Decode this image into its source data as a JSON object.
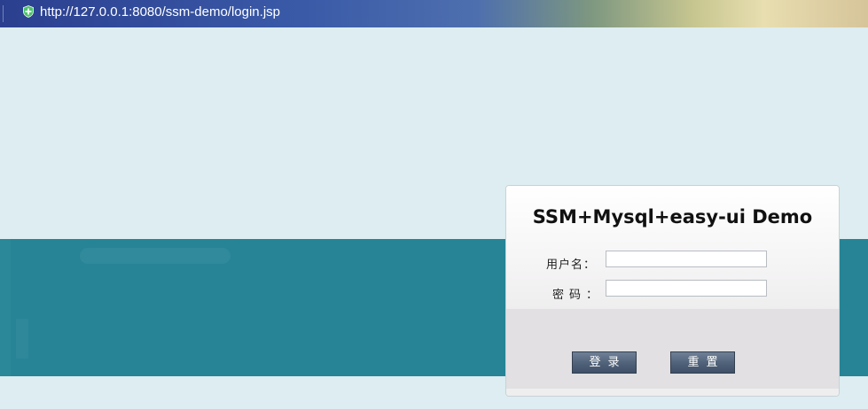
{
  "browser": {
    "url": "http://127.0.0.1:8080/ssm-demo/login.jsp",
    "secure_icon": "shield-plus-icon"
  },
  "login": {
    "title": "SSM+Mysql+easy-ui Demo",
    "username_label": "用户名：",
    "password_label": "密码：",
    "username_value": "",
    "password_value": "",
    "login_button": "登录",
    "reset_button": "重置"
  },
  "colors": {
    "page_background": "#ddedf1",
    "band": "#268496",
    "button": "#4f6178",
    "panel_bottom": "#e2e0e2"
  }
}
